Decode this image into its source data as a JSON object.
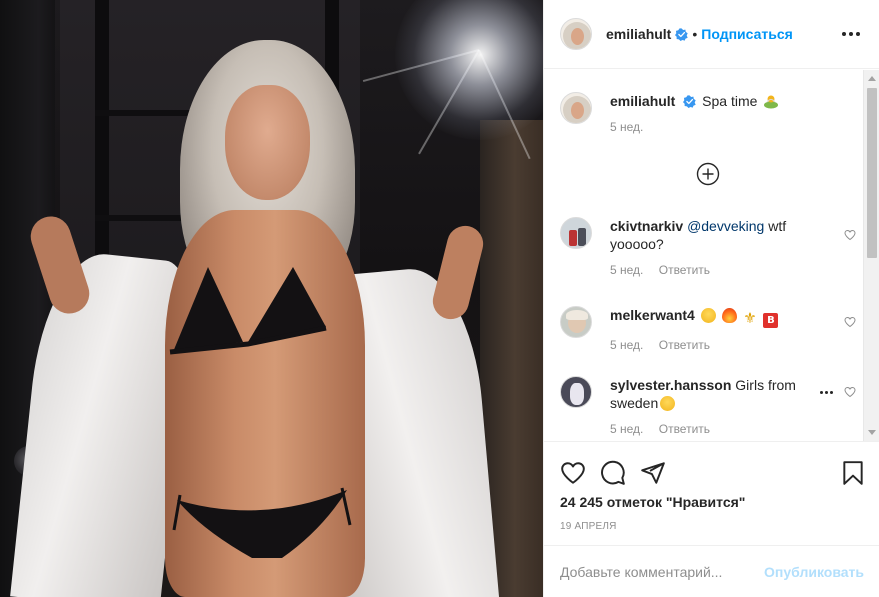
{
  "post": {
    "author": "emiliahult",
    "follow_label": "Подписаться",
    "dot": "•",
    "caption": "Spa time",
    "caption_time": "5 нед.",
    "likes_text": "24 245 отметок \"Нравится\"",
    "date": "19 АПРЕЛЯ"
  },
  "comments": [
    {
      "user": "ckivtnarkiv",
      "mention": "@devveking",
      "text": " wtf yooooo?",
      "time": "5 нед.",
      "reply_label": "Ответить"
    },
    {
      "user": "melkerwant4",
      "text": "",
      "emoji": [
        "smile-emoji",
        "fire-emoji",
        "fleur-de-lis-emoji",
        "b-button-emoji"
      ],
      "emoji_b": "B",
      "emoji_fleur": "⚜",
      "time": "5 нед.",
      "reply_label": "Ответить"
    },
    {
      "user": "sylvester.hansson",
      "text": "Girls from sweden",
      "emoji": [
        "grinning-emoji"
      ],
      "time": "5 нед.",
      "reply_label": "Ответить"
    }
  ],
  "add_comment": {
    "placeholder": "Добавьте комментарий...",
    "publish_label": "Опубликовать"
  },
  "icons": {
    "header": [
      "verified-badge-icon",
      "more-options-icon"
    ],
    "actions": [
      "heart-icon",
      "comment-icon",
      "share-icon",
      "bookmark-icon"
    ],
    "load_more": "plus-circle-icon"
  },
  "colors": {
    "accent": "#0095f6",
    "publish_disabled": "#b2dffc",
    "muted": "#8e8e8e",
    "text": "#262626"
  }
}
